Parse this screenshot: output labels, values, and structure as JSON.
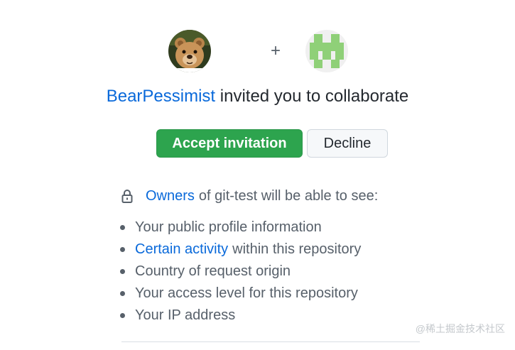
{
  "invite": {
    "inviter": "BearPessimist",
    "headline_rest": "invited you to collaborate",
    "plus_sign": "+",
    "user_avatar_icon": "teddy-bear-avatar",
    "repo_avatar_icon": "identicon-avatar",
    "identicon_color": "#8fd078"
  },
  "actions": {
    "accept_label": "Accept invitation",
    "decline_label": "Decline"
  },
  "notice": {
    "icon": "lock-icon",
    "owners_link": "Owners",
    "text": "of git-test will be able to see:"
  },
  "permissions": {
    "items": [
      {
        "link": "",
        "text": "Your public profile information"
      },
      {
        "link": "Certain activity",
        "text": "within this repository"
      },
      {
        "link": "",
        "text": "Country of request origin"
      },
      {
        "link": "",
        "text": "Your access level for this repository"
      },
      {
        "link": "",
        "text": "Your IP address"
      }
    ]
  },
  "watermark": "@稀土掘金技术社区",
  "colors": {
    "accent_link": "#0969da",
    "accept_green": "#2da44e",
    "text_muted": "#57606a"
  }
}
